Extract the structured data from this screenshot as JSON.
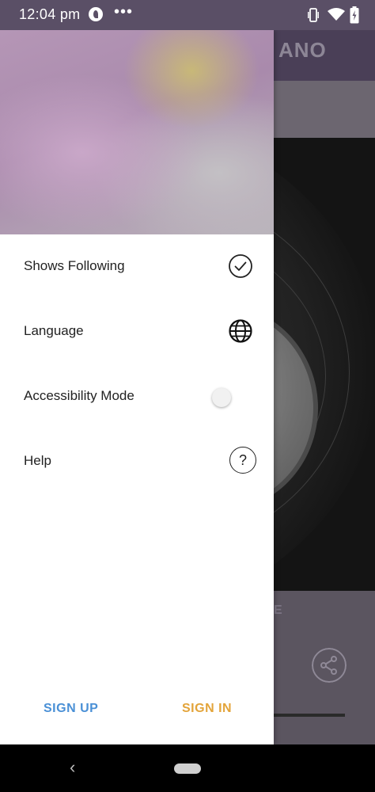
{
  "status": {
    "time": "12:04 pm",
    "dots": "•••"
  },
  "background_app": {
    "title_partial": "ANO",
    "bottom_text_partial": "E"
  },
  "drawer": {
    "items": [
      {
        "label": "Shows Following",
        "icon": "check-circle-icon"
      },
      {
        "label": "Language",
        "icon": "globe-icon"
      },
      {
        "label": "Accessibility Mode",
        "icon": "toggle-switch",
        "toggle_on": false
      },
      {
        "label": "Help",
        "icon": "help-circle-icon",
        "glyph": "?"
      }
    ],
    "footer": {
      "signup_label": "SIGN UP",
      "signin_label": "SIGN IN"
    }
  },
  "colors": {
    "signup": "#4a90d6",
    "signin": "#e3a43a"
  },
  "navbar": {
    "back_glyph": "‹"
  }
}
